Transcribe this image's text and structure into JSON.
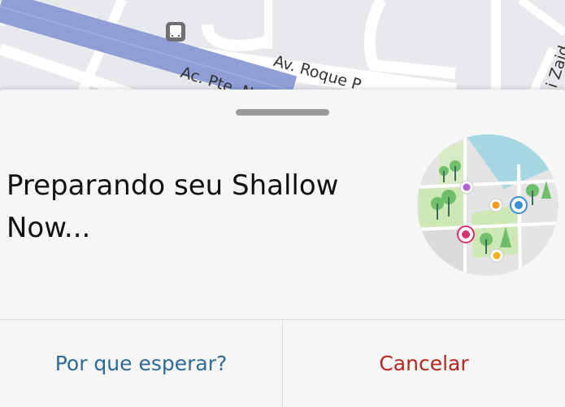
{
  "map": {
    "streets": [
      "Av. Roque P",
      "Ac. Pte. N",
      "i Zaid"
    ],
    "road_color": "#8f9fd6"
  },
  "sheet": {
    "title": "Preparando seu Shallow Now...",
    "actions": {
      "why_wait": "Por que esperar?",
      "cancel": "Cancelar"
    }
  },
  "colors": {
    "why_wait": "#2d6a95",
    "cancel": "#b3261e"
  }
}
